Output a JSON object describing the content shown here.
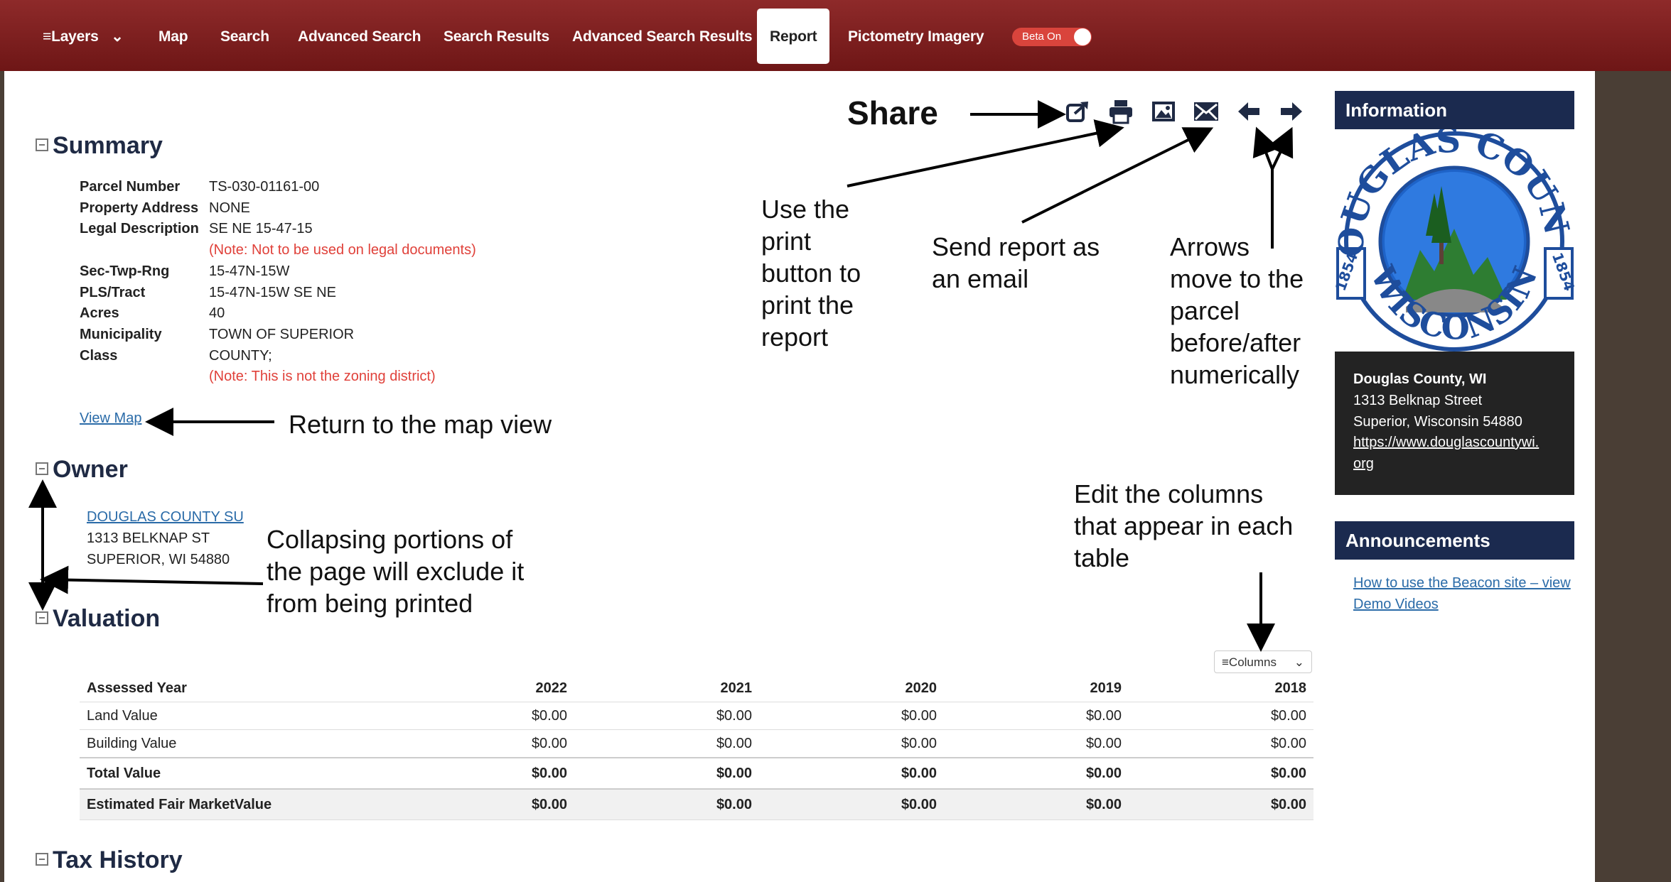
{
  "nav": {
    "layers": "Layers",
    "map": "Map",
    "search": "Search",
    "advanced_search": "Advanced Search",
    "search_results": "Search Results",
    "advanced_search_results": "Advanced Search Results",
    "report": "Report",
    "pictometry": "Pictometry Imagery",
    "beta": "Beta On"
  },
  "toolbar": {
    "share_label": "Share",
    "icons": [
      "share-icon",
      "print-icon",
      "image-icon",
      "email-icon",
      "arrow-left-icon",
      "arrow-right-icon"
    ]
  },
  "summary": {
    "title": "Summary",
    "rows": [
      {
        "label": "Parcel Number",
        "value": "TS-030-01161-00"
      },
      {
        "label": "Property Address",
        "value": "NONE"
      },
      {
        "label": "Legal Description",
        "value": "SE NE 15-47-15",
        "note": "(Note: Not to be used on legal documents)"
      },
      {
        "label": "Sec-Twp-Rng",
        "value": "15-47N-15W"
      },
      {
        "label": "PLS/Tract",
        "value": "15-47N-15W SE NE"
      },
      {
        "label": "Acres",
        "value": "40"
      },
      {
        "label": "Municipality",
        "value": "TOWN OF SUPERIOR"
      },
      {
        "label": "Class",
        "value": "COUNTY;",
        "note": "(Note: This is not the zoning district)"
      }
    ],
    "view_map": "View Map"
  },
  "owner": {
    "title": "Owner",
    "name": "DOUGLAS COUNTY SU",
    "street": "1313 BELKNAP ST",
    "city": "SUPERIOR, WI 54880"
  },
  "valuation": {
    "title": "Valuation",
    "columns_button": "Columns",
    "headers": [
      "Assessed Year",
      "2022",
      "2021",
      "2020",
      "2019",
      "2018"
    ],
    "rows": [
      {
        "label": "Land Value",
        "values": [
          "$0.00",
          "$0.00",
          "$0.00",
          "$0.00",
          "$0.00"
        ]
      },
      {
        "label": "Building Value",
        "values": [
          "$0.00",
          "$0.00",
          "$0.00",
          "$0.00",
          "$0.00"
        ]
      },
      {
        "label": "Total Value",
        "values": [
          "$0.00",
          "$0.00",
          "$0.00",
          "$0.00",
          "$0.00"
        ]
      },
      {
        "label": "Estimated Fair MarketValue",
        "values": [
          "$0.00",
          "$0.00",
          "$0.00",
          "$0.00",
          "$0.00"
        ]
      }
    ]
  },
  "tax_history": {
    "title": "Tax History"
  },
  "sidebar": {
    "information": "Information",
    "seal_top": "DOUGLAS COUNTY",
    "seal_bottom": "WISCONSIN",
    "seal_year_left": "1854",
    "seal_year_right": "1854",
    "org_name": "Douglas County, WI",
    "org_street": "1313 Belknap Street",
    "org_city": "Superior, Wisconsin 54880",
    "org_url_1": "https://www.douglascountywi.",
    "org_url_2": "org",
    "announcements": "Announcements",
    "announce_link_1": "How to use the Beacon site – view",
    "announce_link_2": "Demo Videos"
  },
  "annotations": {
    "print": [
      "Use the",
      "print",
      "button to",
      "print the",
      "report"
    ],
    "email": [
      "Send report as",
      "an email"
    ],
    "arrows": [
      "Arrows",
      "move to the",
      "parcel",
      "before/after",
      "numerically"
    ],
    "return_map": "Return to the map view",
    "collapse": [
      "Collapsing portions of",
      "the page will exclude it",
      "from being printed"
    ],
    "columns": [
      "Edit the columns",
      "that appear in each",
      "table"
    ]
  },
  "colors": {
    "nav_red": "#7a1c1c",
    "panel_navy": "#1b2a4f",
    "note_red": "#e0413a",
    "link_blue": "#2a6ba8"
  }
}
